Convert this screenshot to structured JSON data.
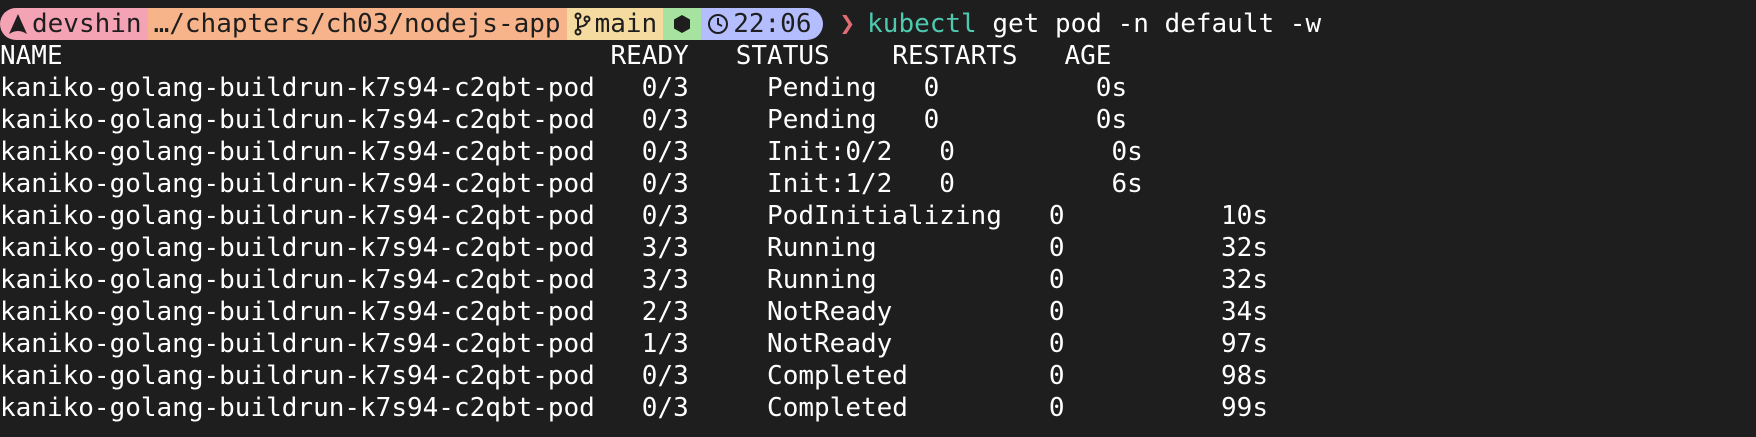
{
  "prompt": {
    "user": "devshin",
    "path": "…/chapters/ch03/nodejs-app",
    "branch": "main",
    "time": "22:06",
    "chevron": "❯",
    "command_name": "kubectl",
    "command_args": " get pod -n default -w",
    "colors": {
      "user_bg": "#f4a3b5",
      "path_bg": "#f7b48a",
      "branch_bg": "#f5dba0",
      "node_bg": "#a6e3a1",
      "time_bg": "#b4befe",
      "chevron": "#e06c75",
      "command": "#4ec9b0"
    },
    "icons": {
      "user": "arch-logo-icon",
      "branch": "git-branch-icon",
      "node": "nodejs-hexagon-icon",
      "time": "clock-icon"
    }
  },
  "table": {
    "headers": [
      "NAME",
      "READY",
      "STATUS",
      "RESTARTS",
      "AGE"
    ],
    "rows": [
      [
        "kaniko-golang-buildrun-k7s94-c2qbt-pod",
        "0/3",
        "Pending",
        "0",
        "0s"
      ],
      [
        "kaniko-golang-buildrun-k7s94-c2qbt-pod",
        "0/3",
        "Pending",
        "0",
        "0s"
      ],
      [
        "kaniko-golang-buildrun-k7s94-c2qbt-pod",
        "0/3",
        "Init:0/2",
        "0",
        "0s"
      ],
      [
        "kaniko-golang-buildrun-k7s94-c2qbt-pod",
        "0/3",
        "Init:1/2",
        "0",
        "6s"
      ],
      [
        "kaniko-golang-buildrun-k7s94-c2qbt-pod",
        "0/3",
        "PodInitializing",
        "0",
        "10s"
      ],
      [
        "kaniko-golang-buildrun-k7s94-c2qbt-pod",
        "3/3",
        "Running",
        "0",
        "32s"
      ],
      [
        "kaniko-golang-buildrun-k7s94-c2qbt-pod",
        "3/3",
        "Running",
        "0",
        "32s"
      ],
      [
        "kaniko-golang-buildrun-k7s94-c2qbt-pod",
        "2/3",
        "NotReady",
        "0",
        "34s"
      ],
      [
        "kaniko-golang-buildrun-k7s94-c2qbt-pod",
        "1/3",
        "NotReady",
        "0",
        "97s"
      ],
      [
        "kaniko-golang-buildrun-k7s94-c2qbt-pod",
        "0/3",
        "Completed",
        "0",
        "98s"
      ],
      [
        "kaniko-golang-buildrun-k7s94-c2qbt-pod",
        "0/3",
        "Completed",
        "0",
        "99s"
      ]
    ]
  }
}
